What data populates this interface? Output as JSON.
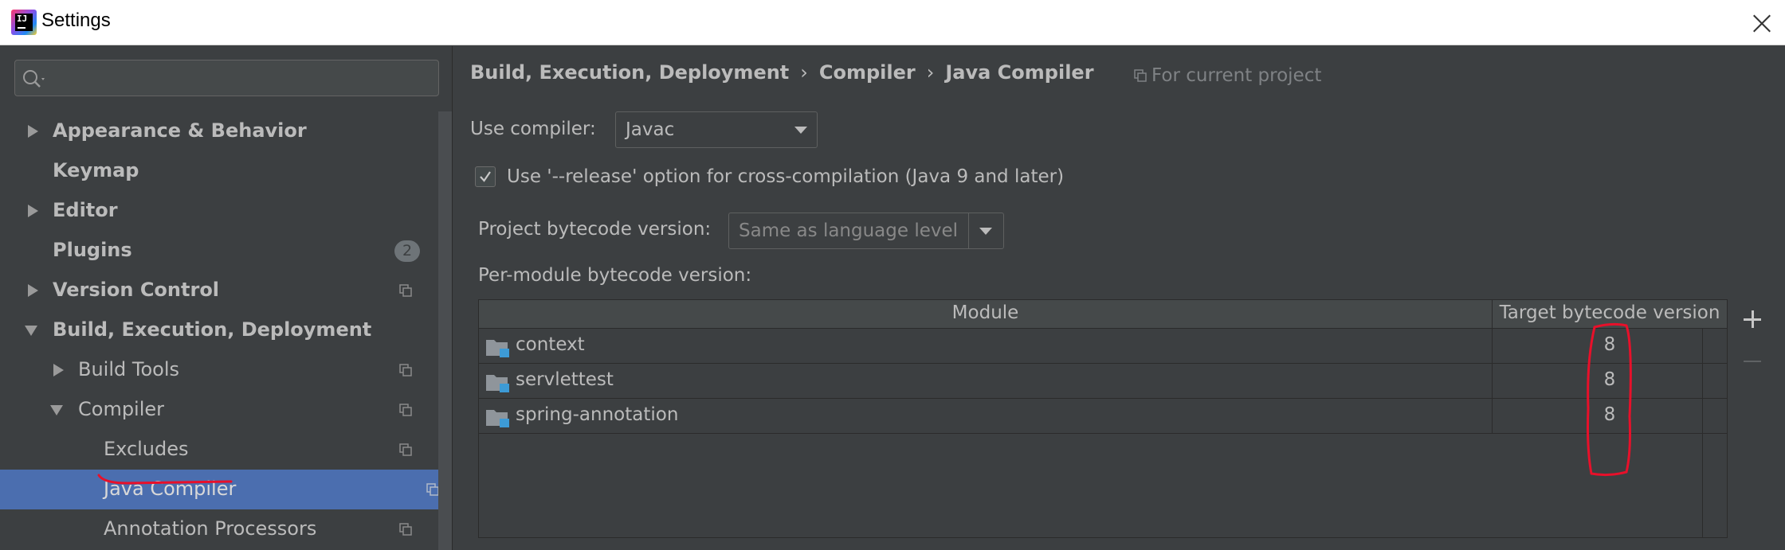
{
  "window": {
    "title": "Settings"
  },
  "search": {
    "placeholder": ""
  },
  "sidebar": {
    "items": [
      {
        "label": "Appearance & Behavior",
        "level": 0,
        "expanded": false,
        "bold": true,
        "has_arrow": true
      },
      {
        "label": "Keymap",
        "level": 0,
        "bold": true,
        "has_arrow": false
      },
      {
        "label": "Editor",
        "level": 0,
        "expanded": false,
        "bold": true,
        "has_arrow": true
      },
      {
        "label": "Plugins",
        "level": 0,
        "bold": true,
        "has_arrow": false,
        "badge": "2"
      },
      {
        "label": "Version Control",
        "level": 0,
        "expanded": false,
        "bold": true,
        "has_arrow": true,
        "project_icon": true
      },
      {
        "label": "Build, Execution, Deployment",
        "level": 0,
        "expanded": true,
        "bold": true,
        "has_arrow": true
      },
      {
        "label": "Build Tools",
        "level": 1,
        "expanded": false,
        "has_arrow": true,
        "project_icon": true
      },
      {
        "label": "Compiler",
        "level": 1,
        "expanded": true,
        "has_arrow": true,
        "project_icon": true
      },
      {
        "label": "Excludes",
        "level": 2,
        "has_arrow": false,
        "project_icon": true
      },
      {
        "label": "Java Compiler",
        "level": 2,
        "has_arrow": false,
        "project_icon": true,
        "selected": true
      },
      {
        "label": "Annotation Processors",
        "level": 2,
        "has_arrow": false,
        "project_icon": true
      }
    ]
  },
  "breadcrumb": {
    "parts": [
      "Build, Execution, Deployment",
      "Compiler",
      "Java Compiler"
    ],
    "separator": "›"
  },
  "scope_note": "For current project",
  "compiler": {
    "use_compiler_label": "Use compiler:",
    "use_compiler_value": "Javac",
    "release_option_label": "Use '--release' option for cross-compilation (Java 9 and later)",
    "release_option_checked": true,
    "project_bytecode_label": "Project bytecode version:",
    "project_bytecode_value": "Same as language level",
    "per_module_label": "Per-module bytecode version:"
  },
  "modules_table": {
    "columns": [
      "Module",
      "Target bytecode version"
    ],
    "rows": [
      {
        "module": "context",
        "version": "8"
      },
      {
        "module": "servlettest",
        "version": "8"
      },
      {
        "module": "spring-annotation",
        "version": "8"
      }
    ]
  },
  "colors": {
    "background": "#3c3f41",
    "selection": "#4b6eaf",
    "text": "#bbbbbb",
    "annotation_red": "#e8102a",
    "module_badge": "#3d9bd6"
  }
}
